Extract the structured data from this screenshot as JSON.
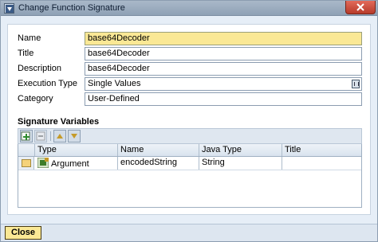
{
  "window": {
    "title": "Change Function Signature"
  },
  "form": {
    "name_label": "Name",
    "name_value": "base64Decoder",
    "title_label": "Title",
    "title_value": "base64Decoder",
    "description_label": "Description",
    "description_value": "base64Decoder",
    "execution_type_label": "Execution Type",
    "execution_type_value": "Single Values",
    "category_label": "Category",
    "category_value": "User-Defined"
  },
  "signature": {
    "section_title": "Signature Variables",
    "columns": [
      "Type",
      "Name",
      "Java Type",
      "Title"
    ],
    "rows": [
      {
        "type": "Argument",
        "name": "encodedString",
        "java_type": "String",
        "title": ""
      }
    ]
  },
  "footer": {
    "close_label": "Close"
  },
  "icons": {
    "title": "window-app-icon",
    "close": "close-icon",
    "add_row": "add-row-icon",
    "delete_row": "delete-row-icon",
    "move_up": "arrow-up-icon",
    "move_down": "arrow-down-icon",
    "argument": "argument-icon",
    "value_help": "value-help-icon"
  },
  "colors": {
    "highlight": "#fae895",
    "titlebar": "#9aabbe",
    "close_x": "#c94a38"
  }
}
